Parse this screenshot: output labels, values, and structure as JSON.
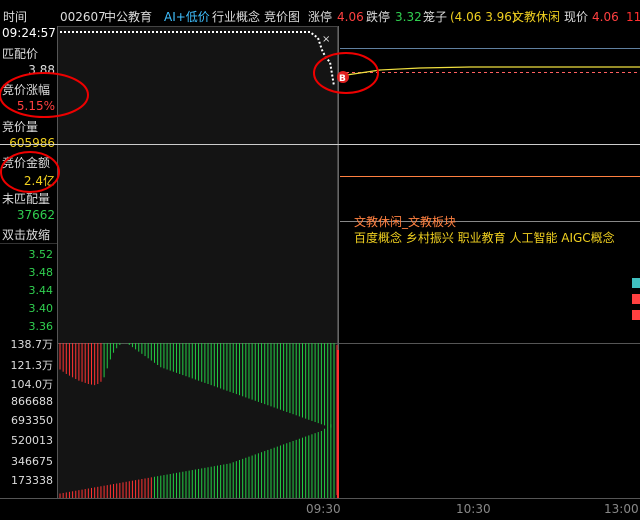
{
  "header": {
    "time_label": "时间",
    "stock_code": "002607",
    "stock_name": "中公教育",
    "ai_label": "AI+低价",
    "industry_label": "行业概念",
    "chart_label": "竞价图",
    "limit_up_label": "涨停",
    "limit_up_value": "4.06",
    "limit_down_label": "跌停",
    "limit_down_value": "3.32",
    "cage_label": "笼子",
    "cage_value": "(4.06 3.96)",
    "sector_label": "文教休闲",
    "price_label": "现价",
    "price_value": "4.06",
    "extra_value": "11",
    "extra_color": "#ff3030"
  },
  "left_panel": {
    "time": "09:24:57",
    "match_price_label": "匹配价",
    "match_price": "3.88",
    "auction_change_label": "竞价涨幅",
    "auction_change": "5.15%",
    "auction_volume_label": "竞价量",
    "auction_volume": "605986",
    "auction_amount_label": "竞价金额",
    "auction_amount": "2.4亿",
    "unmatched_label": "未匹配量",
    "unmatched_value": "37662",
    "zoom_label": "双击放缩"
  },
  "price_axis": [
    "3.52",
    "3.48",
    "3.44",
    "3.40",
    "3.36"
  ],
  "volume_axis": [
    "138.7万",
    "121.3万",
    "104.0万",
    "866688",
    "693350",
    "520013",
    "346675",
    "173338"
  ],
  "x_axis": [
    "09:30",
    "10:30",
    "13:00"
  ],
  "sector_info": {
    "title": "文教休闲_文教板块",
    "tags": "百度概念 乡村振兴 职业教育 人工智能 AIGC概念"
  },
  "marker_label": "B",
  "colors": {
    "up": "#ff3333",
    "down": "#22cc44",
    "yellow": "#f0d020",
    "cyan": "#40c0c0",
    "orange": "#ff8040"
  },
  "chart_data": {
    "type": "bar",
    "title": "",
    "xlabel": "",
    "ylabel": "",
    "price_ylim": [
      3.34,
      3.56
    ],
    "volume_ylim": [
      0,
      1387000
    ],
    "volume_ticks": [
      1387000,
      1213000,
      1040000,
      866688,
      693350,
      520013,
      346675,
      173338
    ],
    "series": [
      {
        "values_top": [
          1387000,
          1387000,
          1387000,
          1387000,
          1387000,
          1387000,
          1387000,
          1387000,
          1387000,
          1387000,
          1387000,
          1387000,
          1387000,
          1387000,
          1387000,
          1387000,
          1387000,
          1387000,
          1387000,
          1387000,
          1387000,
          1387000,
          1387000,
          1387000,
          1387000,
          1387000,
          1387000,
          1387000,
          1387000,
          1387000,
          1387000,
          1387000,
          1387000,
          1387000,
          1387000,
          1387000,
          1387000,
          1387000,
          1387000,
          1387000,
          1387000,
          1387000,
          1387000,
          1387000,
          1387000,
          1387000,
          1387000,
          1387000,
          1387000,
          1387000,
          1387000,
          1387000,
          1387000,
          1387000,
          1387000,
          1387000,
          1387000,
          1387000,
          1387000,
          1387000,
          1387000,
          1387000,
          1387000,
          1387000,
          1387000,
          1387000,
          1387000,
          1387000,
          1387000,
          1387000,
          1387000,
          1387000,
          1387000,
          1387000,
          1387000,
          1387000,
          1387000,
          1387000,
          1387000,
          1387000,
          1387000,
          1387000,
          1387000,
          1387000,
          1387000,
          1387000,
          1387000,
          1387000
        ],
        "values_bottom": [
          1150000,
          1130000,
          1110000,
          1095000,
          1080000,
          1065000,
          1050000,
          1040000,
          1030000,
          1020000,
          1015000,
          1010000,
          1020000,
          1040000,
          1080000,
          1160000,
          1240000,
          1300000,
          1340000,
          1370000,
          1385000,
          1385000,
          1370000,
          1350000,
          1330000,
          1310000,
          1290000,
          1270000,
          1250000,
          1230000,
          1210000,
          1190000,
          1170000,
          1160000,
          1150000,
          1140000,
          1130000,
          1120000,
          1110000,
          1100000,
          1090000,
          1080000,
          1070000,
          1060000,
          1050000,
          1040000,
          1030000,
          1020000,
          1010000,
          1000000,
          990000,
          980000,
          970000,
          960000,
          950000,
          940000,
          930000,
          920000,
          910000,
          900000,
          890000,
          880000,
          870000,
          860000,
          850000,
          840000,
          830000,
          820000,
          810000,
          800000,
          790000,
          780000,
          770000,
          760000,
          750000,
          740000,
          730000,
          720000,
          710000,
          700000,
          690000,
          680000,
          670000,
          660000,
          650000,
          640000,
          630000,
          620000
        ]
      },
      {
        "name": "",
        "bottom_up": [
          40000,
          45000,
          50000,
          55000,
          60000,
          65000,
          70000,
          75000,
          80000,
          85000,
          90000,
          95000,
          100000,
          105000,
          110000,
          115000,
          120000,
          125000,
          130000,
          135000,
          140000,
          145000,
          150000,
          155000,
          160000,
          165000,
          170000,
          175000,
          180000,
          185000,
          190000,
          195000,
          200000,
          205000,
          210000,
          215000,
          220000,
          225000,
          230000,
          235000,
          240000,
          245000,
          250000,
          255000,
          260000,
          265000,
          270000,
          275000,
          280000,
          285000,
          290000,
          295000,
          300000,
          305000,
          310000,
          320000,
          330000,
          340000,
          350000,
          360000,
          370000,
          380000,
          390000,
          400000,
          410000,
          420000,
          430000,
          440000,
          450000,
          460000,
          470000,
          480000,
          490000,
          500000,
          510000,
          520000,
          530000,
          540000,
          550000,
          560000,
          570000,
          580000,
          590000,
          600000,
          620000,
          640000,
          660000,
          690000
        ]
      }
    ]
  }
}
